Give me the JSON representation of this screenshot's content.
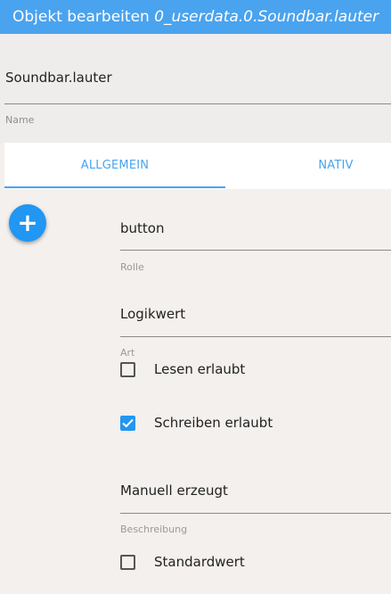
{
  "dialog": {
    "title_prefix": "Objekt bearbeiten",
    "object_id": "0_userdata.0.Soundbar.lauter"
  },
  "name_field": {
    "value": "Soundbar.lauter",
    "label": "Name"
  },
  "tabs": [
    {
      "label": "ALLGEMEIN",
      "active": true
    },
    {
      "label": "NATIV",
      "active": false
    }
  ],
  "add_button": {
    "icon": "plus-icon",
    "symbol": "+"
  },
  "fields": {
    "rolle": {
      "value": "button",
      "label": "Rolle"
    },
    "art": {
      "value": "Logikwert",
      "label": "Art"
    },
    "beschreibung": {
      "value": "Manuell erzeugt",
      "label": "Beschreibung"
    }
  },
  "checkboxes": {
    "lesen": {
      "label": "Lesen erlaubt",
      "checked": false
    },
    "schreiben": {
      "label": "Schreiben erlaubt",
      "checked": true
    },
    "standardwert": {
      "label": "Standardwert",
      "checked": false
    }
  },
  "colors": {
    "accent": "#4aa3ee",
    "fab": "#2196f3"
  }
}
